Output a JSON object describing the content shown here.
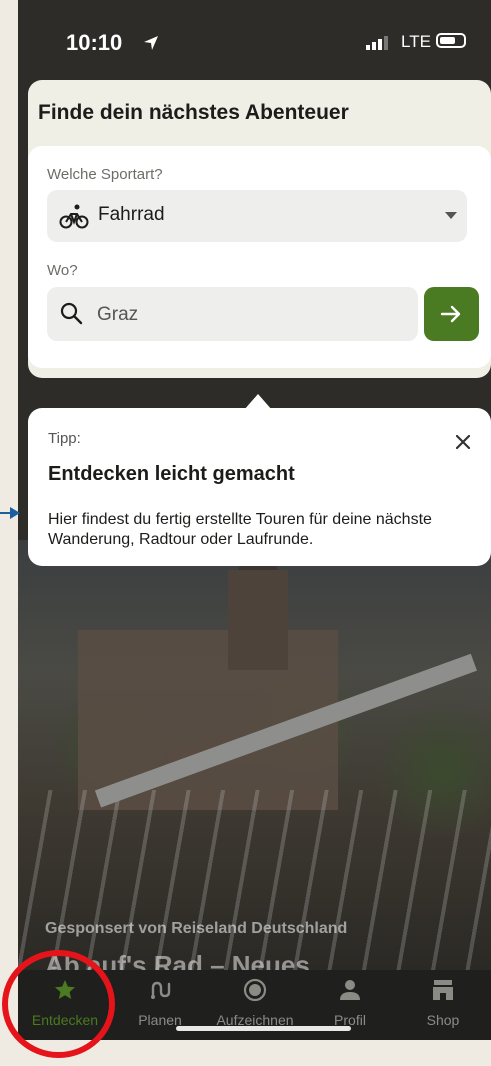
{
  "status_bar": {
    "time": "10:10",
    "network": "LTE"
  },
  "search": {
    "headline": "Finde dein nächstes Abenteuer",
    "sport_label": "Welche Sportart?",
    "sport_value": "Fahrrad",
    "where_label": "Wo?",
    "location_value": "Graz"
  },
  "tooltip": {
    "label": "Tipp:",
    "title": "Entdecken leicht gemacht",
    "body": "Hier findest du fertig erstellte Touren für deine nächste Wanderung, Radtour oder Laufrunde."
  },
  "feature": {
    "sponsor": "Gesponsert von Reiseland Deutschland",
    "title": "Ab auf's Rad – Neues"
  },
  "nav": {
    "items": [
      {
        "label": "Entdecken",
        "icon": "star-icon",
        "active": true
      },
      {
        "label": "Planen",
        "icon": "route-icon",
        "active": false
      },
      {
        "label": "Aufzeichnen",
        "icon": "record-icon",
        "active": false
      },
      {
        "label": "Profil",
        "icon": "profile-icon",
        "active": false
      },
      {
        "label": "Shop",
        "icon": "shop-icon",
        "active": false
      }
    ]
  },
  "colors": {
    "accent": "#4a7a21",
    "highlight": "#e5141a",
    "tooltip_bg": "#ffffff",
    "card_bg": "#f0efe6"
  }
}
